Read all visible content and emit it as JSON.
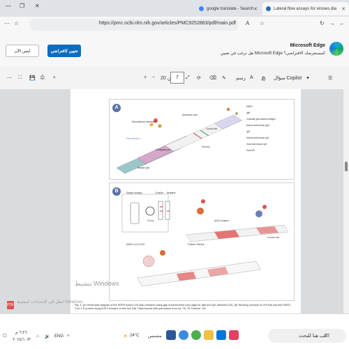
{
  "tabs": [
    {
      "label": "google translate - Search",
      "color": "#4285f4"
    },
    {
      "label": "Lateral flow assays for viruses dia",
      "color": "#2a6cb6"
    }
  ],
  "address": {
    "url": "https://pmc.ncbi.nlm.nih.gov/articles/PMC9252863/pdf/main.pdf"
  },
  "banner": {
    "title": "Microsoft Edge",
    "text": "هل ترغب في تعيين Microsoft Edge كمستعرضك الافتراضي؟",
    "primary": "تعيين كافتراضي",
    "secondary": "ليس الآن"
  },
  "pdf": {
    "copilot": "سؤال Copilot",
    "draw": "رسم",
    "page_current": "7",
    "page_total": "من 20"
  },
  "figure": {
    "label_a": "A",
    "label_b": "B",
    "labels_a": [
      "Nitrocellulose membrane",
      "Absorption pad",
      "Conjugate pad",
      "Sample pad",
      "Flow direction",
      "Test line",
      "Control line"
    ],
    "legend_a": [
      "SARS",
      "IgM",
      "Colloidal gold-labeled antigen",
      "Mouse anti-human IgM",
      "IgG",
      "Mouse anti-human IgG",
      "Goat anti-mouse IgG",
      "Gold NP"
    ],
    "labels_b": [
      "Sample loading",
      "Positive",
      "Negative",
      "20 min",
      "SARS-CoV-2 LFIA",
      "Positive Test line",
      "Control Line",
      "ACE2 receptor"
    ]
  },
  "caption": "Fig. 4. (A) Schematic diagram of the SERS based LFA strip prepared using gap enhancement nano-tags for IgM and IgG detection [15]. (B) Working principle of LFA that can test SARS-CoV-2 S protein using ACE2 receptor in test line [16]. Reproduced with permission from ref. 76–78, Elsevier Ltd.",
  "watermark": {
    "title": "تنشيط Windows",
    "sub": "انتقل إلى الإعدادات لتنشيط Windows."
  },
  "taskbar": {
    "search": "اكتب هنا للبحث",
    "weather": "24°C",
    "weather_text": "مشمس",
    "time": "٦:٢٦ م",
    "date": "٢٠٢٤/١٠/٣"
  }
}
